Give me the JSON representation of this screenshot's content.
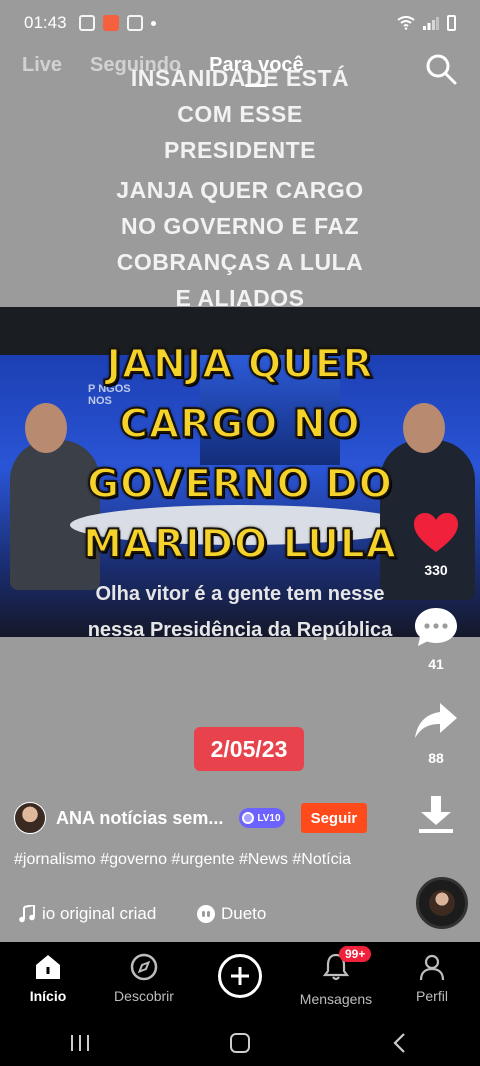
{
  "status_bar": {
    "time": "01:43"
  },
  "top_tabs": [
    {
      "label": "Live",
      "active": false
    },
    {
      "label": "Seguindo",
      "active": false
    },
    {
      "label": "Para você",
      "active": true
    }
  ],
  "headline": {
    "lines_a": [
      "INSANIDADE ESTÁ",
      "COM ESSE",
      "PRESIDENTE"
    ],
    "lines_b": [
      "JANJA QUER CARGO",
      "NO GOVERNO E FAZ",
      "COBRANÇAS A LULA",
      "E ALIADOS"
    ]
  },
  "video": {
    "logo_text": "P NGOS\nNOS",
    "caption_lines": [
      "JANJA QUER",
      "CARGO NO",
      "GOVERNO DO",
      "MARIDO LULA"
    ],
    "subtitle_lines": [
      "Olha vitor é a gente tem nesse",
      "nessa Presidência da República"
    ]
  },
  "date_badge": "2/05/23",
  "actions": {
    "likes": "330",
    "comments": "41",
    "shares": "88"
  },
  "author": {
    "name": "ANA notícias sem...",
    "level": "LV10",
    "follow_label": "Seguir"
  },
  "hashtags": "#jornalismo #governo #urgente #News #Notícia",
  "sound": {
    "text": "io original criad",
    "duet_label": "Dueto"
  },
  "bottom_nav": {
    "home": "Início",
    "discover": "Descobrir",
    "messages": "Mensagens",
    "messages_badge": "99+",
    "profile": "Perfil"
  },
  "colors": {
    "accent": "#ff4a1c",
    "like": "#f0213a",
    "caption_yellow": "#f6d32a",
    "date_badge": "#e8434c"
  }
}
